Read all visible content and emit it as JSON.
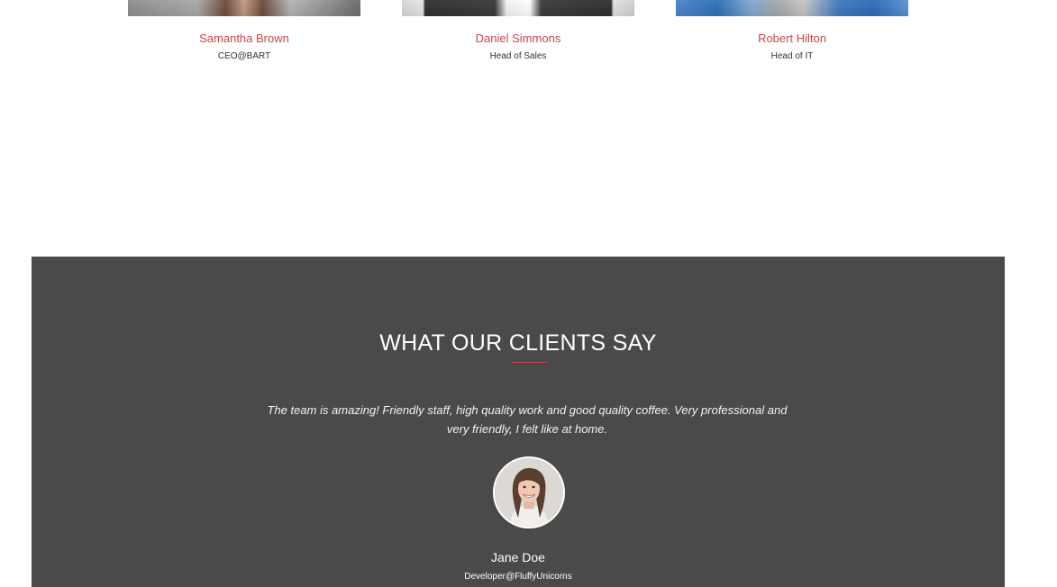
{
  "team": {
    "members": [
      {
        "name": "Samantha Brown",
        "role": "CEO@BART"
      },
      {
        "name": "Daniel Simmons",
        "role": "Head of Sales"
      },
      {
        "name": "Robert Hilton",
        "role": "Head of IT"
      }
    ]
  },
  "testimonials": {
    "title": "WHAT OUR CLIENTS SAY",
    "quote": "The team is amazing! Friendly staff, high quality work and good quality coffee. Very professional and very friendly, I felt like at home.",
    "author_name": "Jane Doe",
    "author_role": "Developer@FluffyUnicorns"
  },
  "colors": {
    "accent": "#c9464a",
    "testimonial_bg": "#4a4a4a",
    "page_bg": "#ffffff"
  }
}
